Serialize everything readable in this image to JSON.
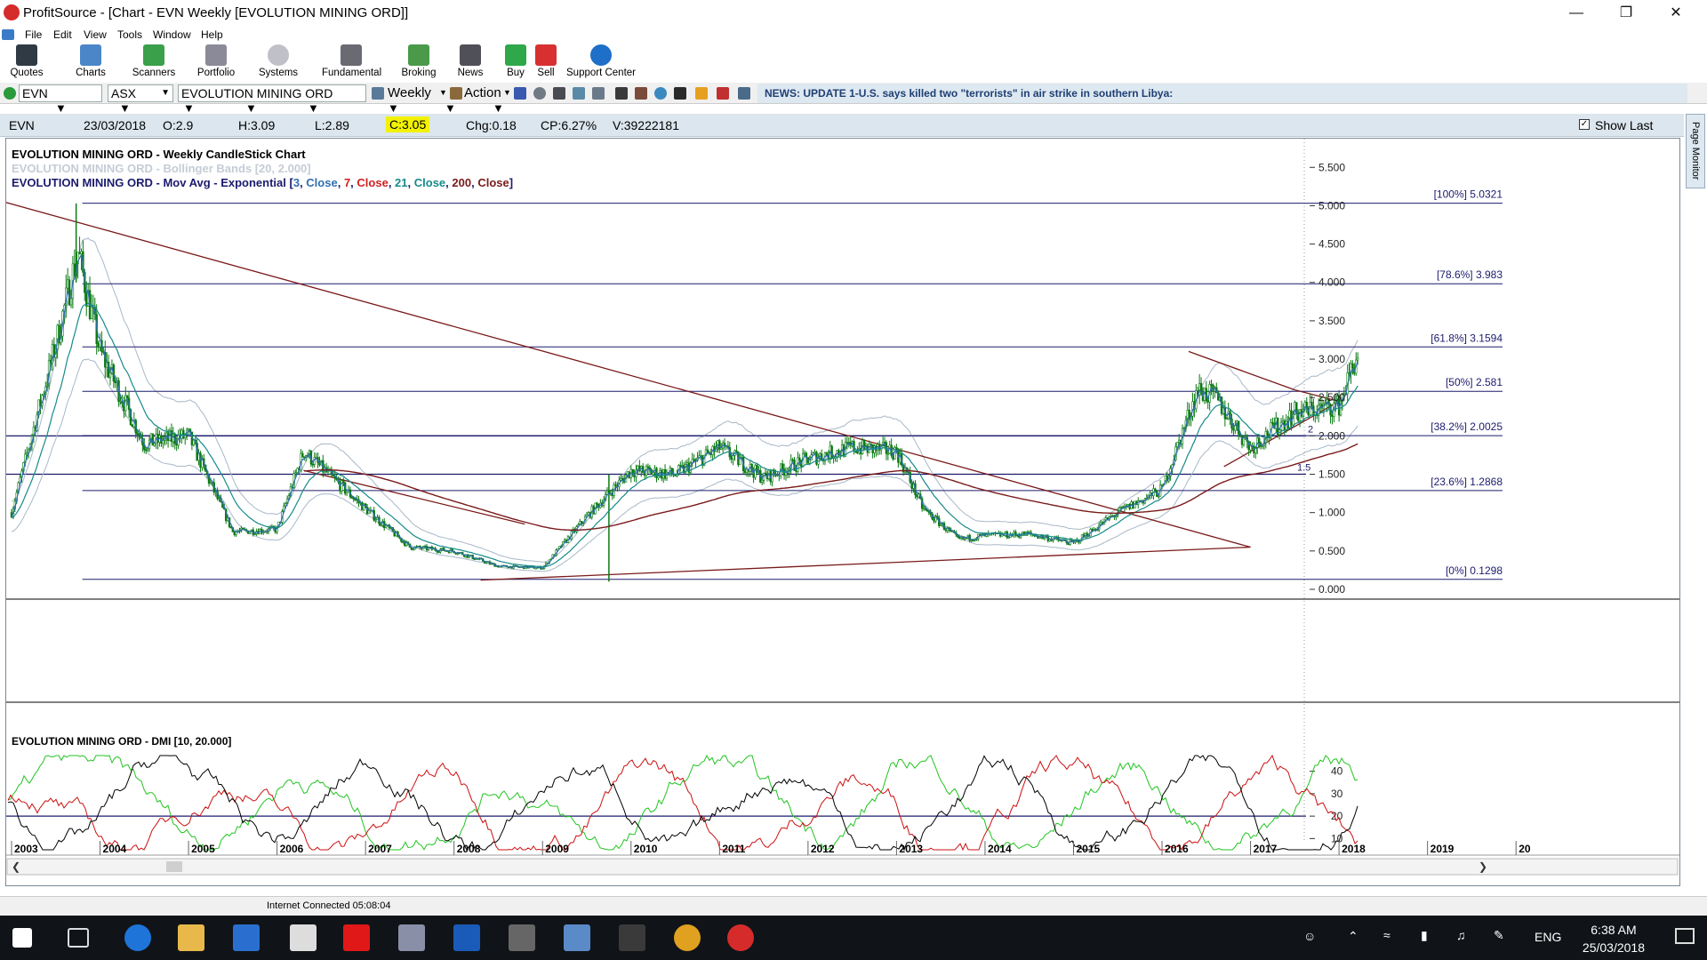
{
  "window": {
    "title": "ProfitSource - [Chart - EVN Weekly [EVOLUTION MINING ORD]]"
  },
  "menu": [
    "File",
    "Edit",
    "View",
    "Tools",
    "Window",
    "Help"
  ],
  "toolbar": [
    "Quotes",
    "Charts",
    "Scanners",
    "Portfolio",
    "Systems",
    "Fundamental",
    "Broking",
    "News",
    "Buy",
    "Sell",
    "Support Center"
  ],
  "symbolbar": {
    "code": "EVN",
    "exchange": "ASX",
    "name": "EVOLUTION MINING ORD",
    "period": "Weekly",
    "action": "Action",
    "news": "NEWS: UPDATE 1-U.S. says killed two \"terrorists\" in air strike in southern Libya:"
  },
  "infobar": {
    "code": "EVN",
    "date": "23/03/2018",
    "open": "O:2.9",
    "high": "H:3.09",
    "low": "L:2.89",
    "close": "C:3.05",
    "change": "Chg:0.18",
    "change_pct": "CP:6.27%",
    "volume": "V:39222181",
    "show_last": "Show Last"
  },
  "page_monitor": "Page Monitor",
  "chart": {
    "title_line": "EVOLUTION MINING ORD - Weekly CandleStick Chart",
    "bb_line": "EVOLUTION MINING ORD - Bollinger Bands [20, 2.000]",
    "ma_prefix": "EVOLUTION MINING ORD - Mov Avg - Exponential [",
    "ma_parts": [
      {
        "text": "3",
        "color": "#2f6fb0"
      },
      {
        "text": ", ",
        "color": "#1b1b6e"
      },
      {
        "text": "Close",
        "color": "#2f6fb0"
      },
      {
        "text": ", ",
        "color": "#1b1b6e"
      },
      {
        "text": "7",
        "color": "#d42020"
      },
      {
        "text": ", ",
        "color": "#1b1b6e"
      },
      {
        "text": "Close",
        "color": "#d42020"
      },
      {
        "text": ", ",
        "color": "#1b1b6e"
      },
      {
        "text": "21",
        "color": "#178a8a"
      },
      {
        "text": ", ",
        "color": "#1b1b6e"
      },
      {
        "text": "Close",
        "color": "#178a8a"
      },
      {
        "text": ", ",
        "color": "#1b1b6e"
      },
      {
        "text": "200",
        "color": "#7a1a1a"
      },
      {
        "text": ", ",
        "color": "#1b1b6e"
      },
      {
        "text": "Close",
        "color": "#7a1a1a"
      },
      {
        "text": "]",
        "color": "#1b1b6e"
      }
    ],
    "dmi_title": "EVOLUTION MINING ORD - DMI [10, 20.000]",
    "price_ticks": [
      "5.500",
      "5.000",
      "4.500",
      "4.000",
      "3.500",
      "3.000",
      "2.500",
      "2.000",
      "1.500",
      "1.000",
      "0.500",
      "0.000"
    ],
    "dmi_ticks": [
      "40",
      "30",
      "20",
      "10"
    ],
    "years": [
      "2003",
      "2004",
      "2005",
      "2006",
      "2007",
      "2008",
      "2009",
      "2010",
      "2011",
      "2012",
      "2013",
      "2014",
      "2015",
      "2016",
      "2017",
      "2018",
      "2019",
      "20"
    ],
    "fib": [
      {
        "label": "[100%] 5.0321",
        "value": 5.0321
      },
      {
        "label": "[78.6%] 3.983",
        "value": 3.983
      },
      {
        "label": "[61.8%] 3.1594",
        "value": 3.1594
      },
      {
        "label": "[50%] 2.581",
        "value": 2.581
      },
      {
        "label": "[38.2%] 2.0025",
        "value": 2.0025
      },
      {
        "label": "[23.6%] 1.2868",
        "value": 1.2868
      },
      {
        "label": "[0%] 0.1298",
        "value": 0.1298
      }
    ],
    "hlines": [
      {
        "label": "2",
        "value": 2.0
      },
      {
        "label": "1.5",
        "value": 1.5
      }
    ],
    "colors": {
      "candle": "#0a7a12",
      "fib": "#1b1b6e",
      "trend": "#7a1a1a",
      "ema3": "#2f6fb0",
      "ema21": "#178a8a",
      "bb": "#a8b8c8",
      "plus_di": "#22c422",
      "minus_di": "#cc1010",
      "adx": "#000000"
    }
  },
  "chart_data": {
    "type": "line",
    "title": "EVOLUTION MINING ORD - Weekly CandleStick Chart",
    "xlabel": "",
    "ylabel": "",
    "ylim": [
      0,
      5.7
    ],
    "x": [
      2003.0,
      2003.5,
      2003.75,
      2004.0,
      2004.5,
      2005.0,
      2005.5,
      2006.0,
      2006.3,
      2007.0,
      2007.5,
      2008.0,
      2008.5,
      2009.0,
      2009.5,
      2010.0,
      2010.5,
      2011.0,
      2011.5,
      2012.0,
      2012.5,
      2013.0,
      2013.3,
      2013.7,
      2014.0,
      2014.5,
      2015.0,
      2015.5,
      2016.0,
      2016.4,
      2016.6,
      2017.0,
      2017.5,
      2018.0,
      2018.2
    ],
    "series": [
      {
        "values": [
          1.0,
          3.2,
          4.4,
          3.1,
          1.9,
          2.0,
          0.75,
          0.78,
          1.8,
          1.05,
          0.55,
          0.5,
          0.3,
          0.28,
          0.95,
          1.55,
          1.5,
          1.85,
          1.45,
          1.7,
          1.85,
          1.8,
          1.05,
          0.65,
          0.7,
          0.72,
          0.6,
          1.0,
          1.3,
          2.6,
          2.5,
          1.85,
          2.3,
          2.4,
          3.05
        ]
      }
    ],
    "indicator": {
      "name": "DMI [10, 20.000]",
      "ylim": [
        5,
        47
      ],
      "threshold": 20
    }
  }
}
